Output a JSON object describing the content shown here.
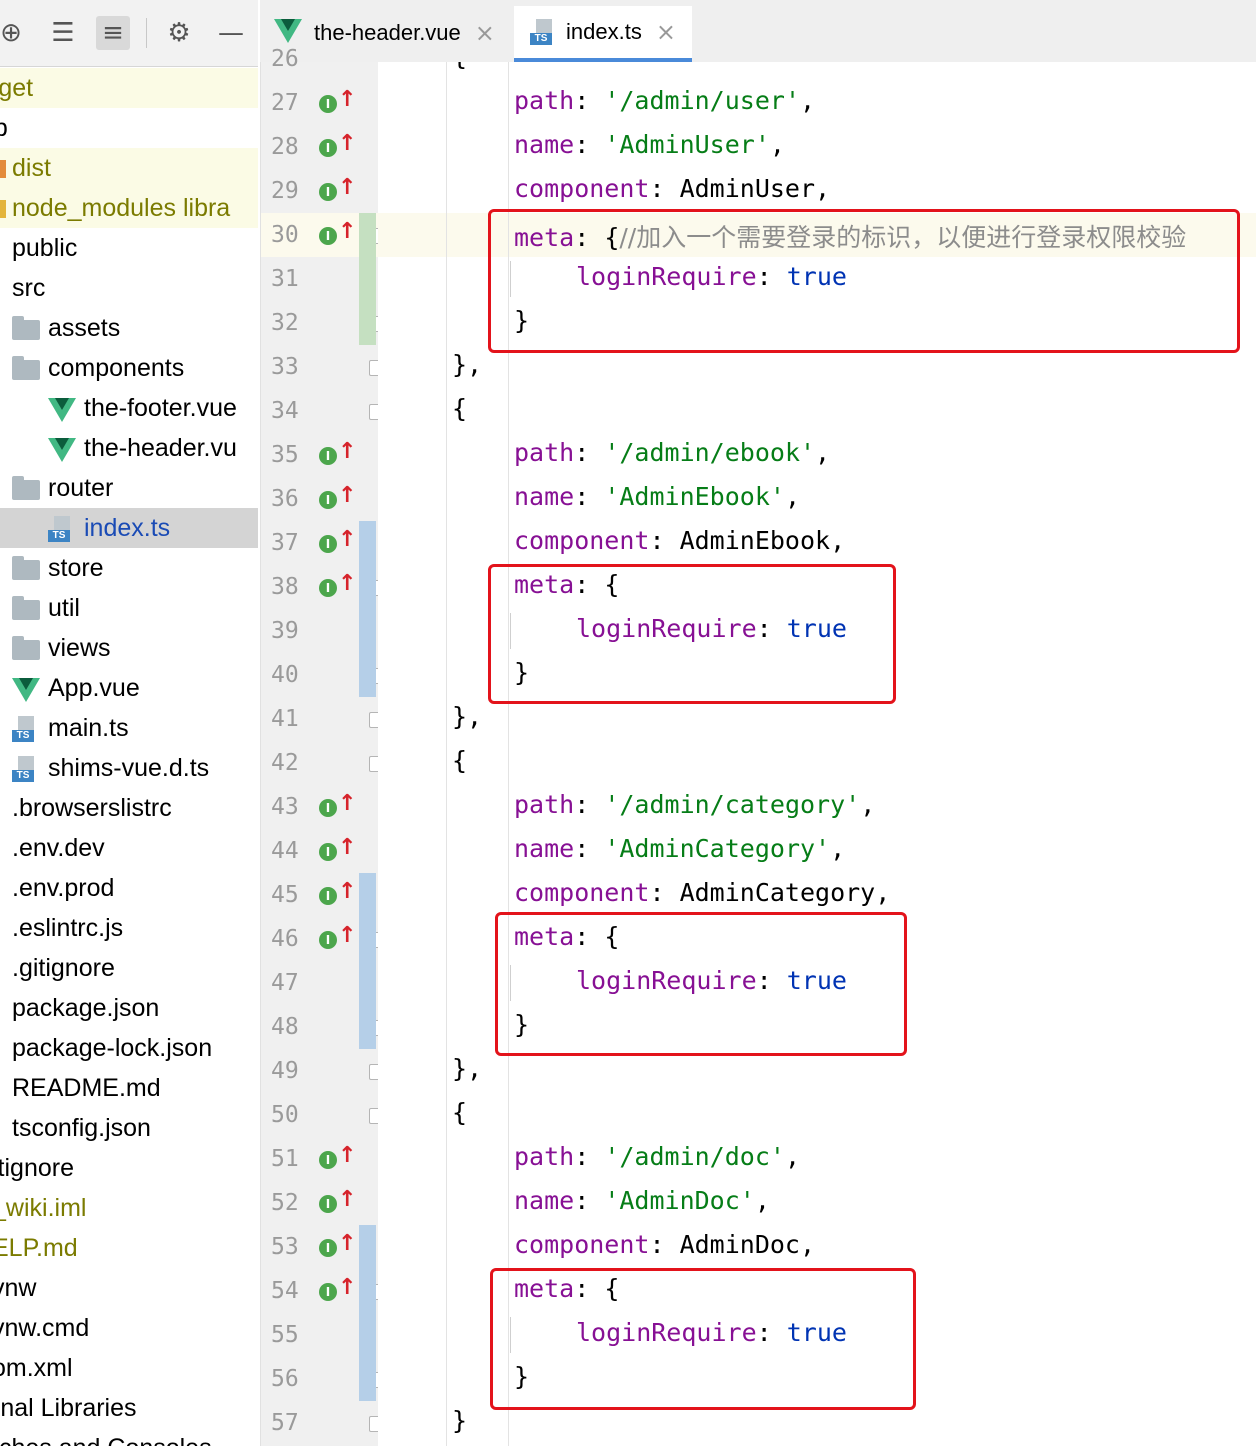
{
  "sidebar": {
    "toolbar_icons": [
      "locate-icon",
      "expand-all-icon",
      "collapse-all-icon",
      "gear-icon",
      "minimize-icon"
    ],
    "items": [
      {
        "label": "rget",
        "icon": "folder-icon",
        "excluded": true
      },
      {
        "label": "eb",
        "icon": "folder-icon"
      },
      {
        "label": "dist",
        "icon": "folder-icon",
        "excluded": true
      },
      {
        "label": "node_modules  libra",
        "icon": "folder-icon",
        "excluded": true
      },
      {
        "label": "public",
        "icon": "folder-icon"
      },
      {
        "label": "src",
        "icon": "folder-icon"
      },
      {
        "label": "assets",
        "icon": "folder-icon"
      },
      {
        "label": "components",
        "icon": "folder-icon"
      },
      {
        "label": "the-footer.vue",
        "icon": "vue-icon"
      },
      {
        "label": "the-header.vu",
        "icon": "vue-icon"
      },
      {
        "label": "router",
        "icon": "folder-icon"
      },
      {
        "label": "index.ts",
        "icon": "typescript-icon",
        "selected": true
      },
      {
        "label": "store",
        "icon": "folder-icon"
      },
      {
        "label": "util",
        "icon": "folder-icon"
      },
      {
        "label": "views",
        "icon": "folder-icon"
      },
      {
        "label": "App.vue",
        "icon": "vue-icon"
      },
      {
        "label": "main.ts",
        "icon": "typescript-icon"
      },
      {
        "label": "shims-vue.d.ts",
        "icon": "typescript-icon"
      },
      {
        "label": ".browserslistrc",
        "icon": "file-icon"
      },
      {
        "label": ".env.dev",
        "icon": "file-icon"
      },
      {
        "label": ".env.prod",
        "icon": "file-icon"
      },
      {
        "label": ".eslintrc.js",
        "icon": "eslint-icon"
      },
      {
        "label": ".gitignore",
        "icon": "file-icon"
      },
      {
        "label": "package.json",
        "icon": "json-icon"
      },
      {
        "label": "package-lock.json",
        "icon": "json-icon"
      },
      {
        "label": "README.md",
        "icon": "markdown-icon"
      },
      {
        "label": "tsconfig.json",
        "icon": "json-icon"
      },
      {
        "label": "itignore",
        "icon": "file-icon"
      },
      {
        "label": "_wiki.iml",
        "icon": "file-icon",
        "excluded_text": true
      },
      {
        "label": "ELP.md",
        "icon": "file-icon",
        "excluded_text": true
      },
      {
        "label": "vnw",
        "icon": "file-icon"
      },
      {
        "label": "vnw.cmd",
        "icon": "file-icon"
      },
      {
        "label": "om.xml",
        "icon": "file-icon"
      },
      {
        "label": "rnal Libraries",
        "icon": "file-icon"
      },
      {
        "label": "tches and Consoles",
        "icon": "file-icon"
      }
    ]
  },
  "tabs": [
    {
      "label": "the-header.vue",
      "icon": "vue-icon",
      "active": false
    },
    {
      "label": "index.ts",
      "icon": "typescript-icon",
      "active": true
    }
  ],
  "editor": {
    "partial_top_line": "26",
    "lines": [
      {
        "n": "27",
        "impl": true,
        "tokens": [
          [
            "k",
            "path"
          ],
          [
            "p",
            ": "
          ],
          [
            "s",
            "'/admin/user'"
          ],
          [
            "p",
            ","
          ]
        ]
      },
      {
        "n": "28",
        "impl": true,
        "tokens": [
          [
            "k",
            "name"
          ],
          [
            "p",
            ": "
          ],
          [
            "s",
            "'AdminUser'"
          ],
          [
            "p",
            ","
          ]
        ]
      },
      {
        "n": "29",
        "impl": true,
        "tokens": [
          [
            "k",
            "component"
          ],
          [
            "p",
            ": AdminUser,"
          ]
        ]
      },
      {
        "n": "30",
        "impl": true,
        "current": true,
        "tokens": [
          [
            "k",
            "meta"
          ],
          [
            "p",
            ": {"
          ],
          [
            "c",
            "//加入一个需要登录的标识，以便进行登录权限校验"
          ]
        ]
      },
      {
        "n": "31",
        "tokens": [
          [
            "k",
            "loginRequire"
          ],
          [
            "p",
            ": "
          ],
          [
            "b",
            "true"
          ]
        ]
      },
      {
        "n": "32",
        "tokens": [
          [
            "p",
            "}"
          ]
        ]
      },
      {
        "n": "33",
        "tokens": [
          [
            "p",
            "},"
          ]
        ]
      },
      {
        "n": "34",
        "tokens": [
          [
            "p",
            "{"
          ]
        ]
      },
      {
        "n": "35",
        "impl": true,
        "tokens": [
          [
            "k",
            "path"
          ],
          [
            "p",
            ": "
          ],
          [
            "s",
            "'/admin/ebook'"
          ],
          [
            "p",
            ","
          ]
        ]
      },
      {
        "n": "36",
        "impl": true,
        "tokens": [
          [
            "k",
            "name"
          ],
          [
            "p",
            ": "
          ],
          [
            "s",
            "'AdminEbook'"
          ],
          [
            "p",
            ","
          ]
        ]
      },
      {
        "n": "37",
        "impl": true,
        "tokens": [
          [
            "k",
            "component"
          ],
          [
            "p",
            ": AdminEbook,"
          ]
        ]
      },
      {
        "n": "38",
        "impl": true,
        "tokens": [
          [
            "k",
            "meta"
          ],
          [
            "p",
            ": {"
          ]
        ]
      },
      {
        "n": "39",
        "tokens": [
          [
            "k",
            "loginRequire"
          ],
          [
            "p",
            ": "
          ],
          [
            "b",
            "true"
          ]
        ]
      },
      {
        "n": "40",
        "tokens": [
          [
            "p",
            "}"
          ]
        ]
      },
      {
        "n": "41",
        "tokens": [
          [
            "p",
            "},"
          ]
        ]
      },
      {
        "n": "42",
        "tokens": [
          [
            "p",
            "{"
          ]
        ]
      },
      {
        "n": "43",
        "impl": true,
        "tokens": [
          [
            "k",
            "path"
          ],
          [
            "p",
            ": "
          ],
          [
            "s",
            "'/admin/category'"
          ],
          [
            "p",
            ","
          ]
        ]
      },
      {
        "n": "44",
        "impl": true,
        "tokens": [
          [
            "k",
            "name"
          ],
          [
            "p",
            ": "
          ],
          [
            "s",
            "'AdminCategory'"
          ],
          [
            "p",
            ","
          ]
        ]
      },
      {
        "n": "45",
        "impl": true,
        "tokens": [
          [
            "k",
            "component"
          ],
          [
            "p",
            ": AdminCategory,"
          ]
        ]
      },
      {
        "n": "46",
        "impl": true,
        "tokens": [
          [
            "k",
            "meta"
          ],
          [
            "p",
            ": {"
          ]
        ]
      },
      {
        "n": "47",
        "tokens": [
          [
            "k",
            "loginRequire"
          ],
          [
            "p",
            ": "
          ],
          [
            "b",
            "true"
          ]
        ]
      },
      {
        "n": "48",
        "tokens": [
          [
            "p",
            "}"
          ]
        ]
      },
      {
        "n": "49",
        "tokens": [
          [
            "p",
            "},"
          ]
        ]
      },
      {
        "n": "50",
        "tokens": [
          [
            "p",
            "{"
          ]
        ]
      },
      {
        "n": "51",
        "impl": true,
        "tokens": [
          [
            "k",
            "path"
          ],
          [
            "p",
            ": "
          ],
          [
            "s",
            "'/admin/doc'"
          ],
          [
            "p",
            ","
          ]
        ]
      },
      {
        "n": "52",
        "impl": true,
        "tokens": [
          [
            "k",
            "name"
          ],
          [
            "p",
            ": "
          ],
          [
            "s",
            "'AdminDoc'"
          ],
          [
            "p",
            ","
          ]
        ]
      },
      {
        "n": "53",
        "impl": true,
        "tokens": [
          [
            "k",
            "component"
          ],
          [
            "p",
            ": AdminDoc,"
          ]
        ]
      },
      {
        "n": "54",
        "impl": true,
        "tokens": [
          [
            "k",
            "meta"
          ],
          [
            "p",
            ": {"
          ]
        ]
      },
      {
        "n": "55",
        "tokens": [
          [
            "k",
            "loginRequire"
          ],
          [
            "p",
            ": "
          ],
          [
            "b",
            "true"
          ]
        ]
      },
      {
        "n": "56",
        "tokens": [
          [
            "p",
            "}"
          ]
        ]
      },
      {
        "n": "57",
        "tokens": [
          [
            "p",
            "}"
          ]
        ]
      }
    ]
  },
  "colors": {
    "keyword": "#871094",
    "string": "#067d17",
    "boolean": "#0033b3",
    "comment": "#8c8c8c",
    "highlight_box": "#e3131b",
    "added_change": "#c5e0c1",
    "modified_change": "#b5cfe8"
  }
}
